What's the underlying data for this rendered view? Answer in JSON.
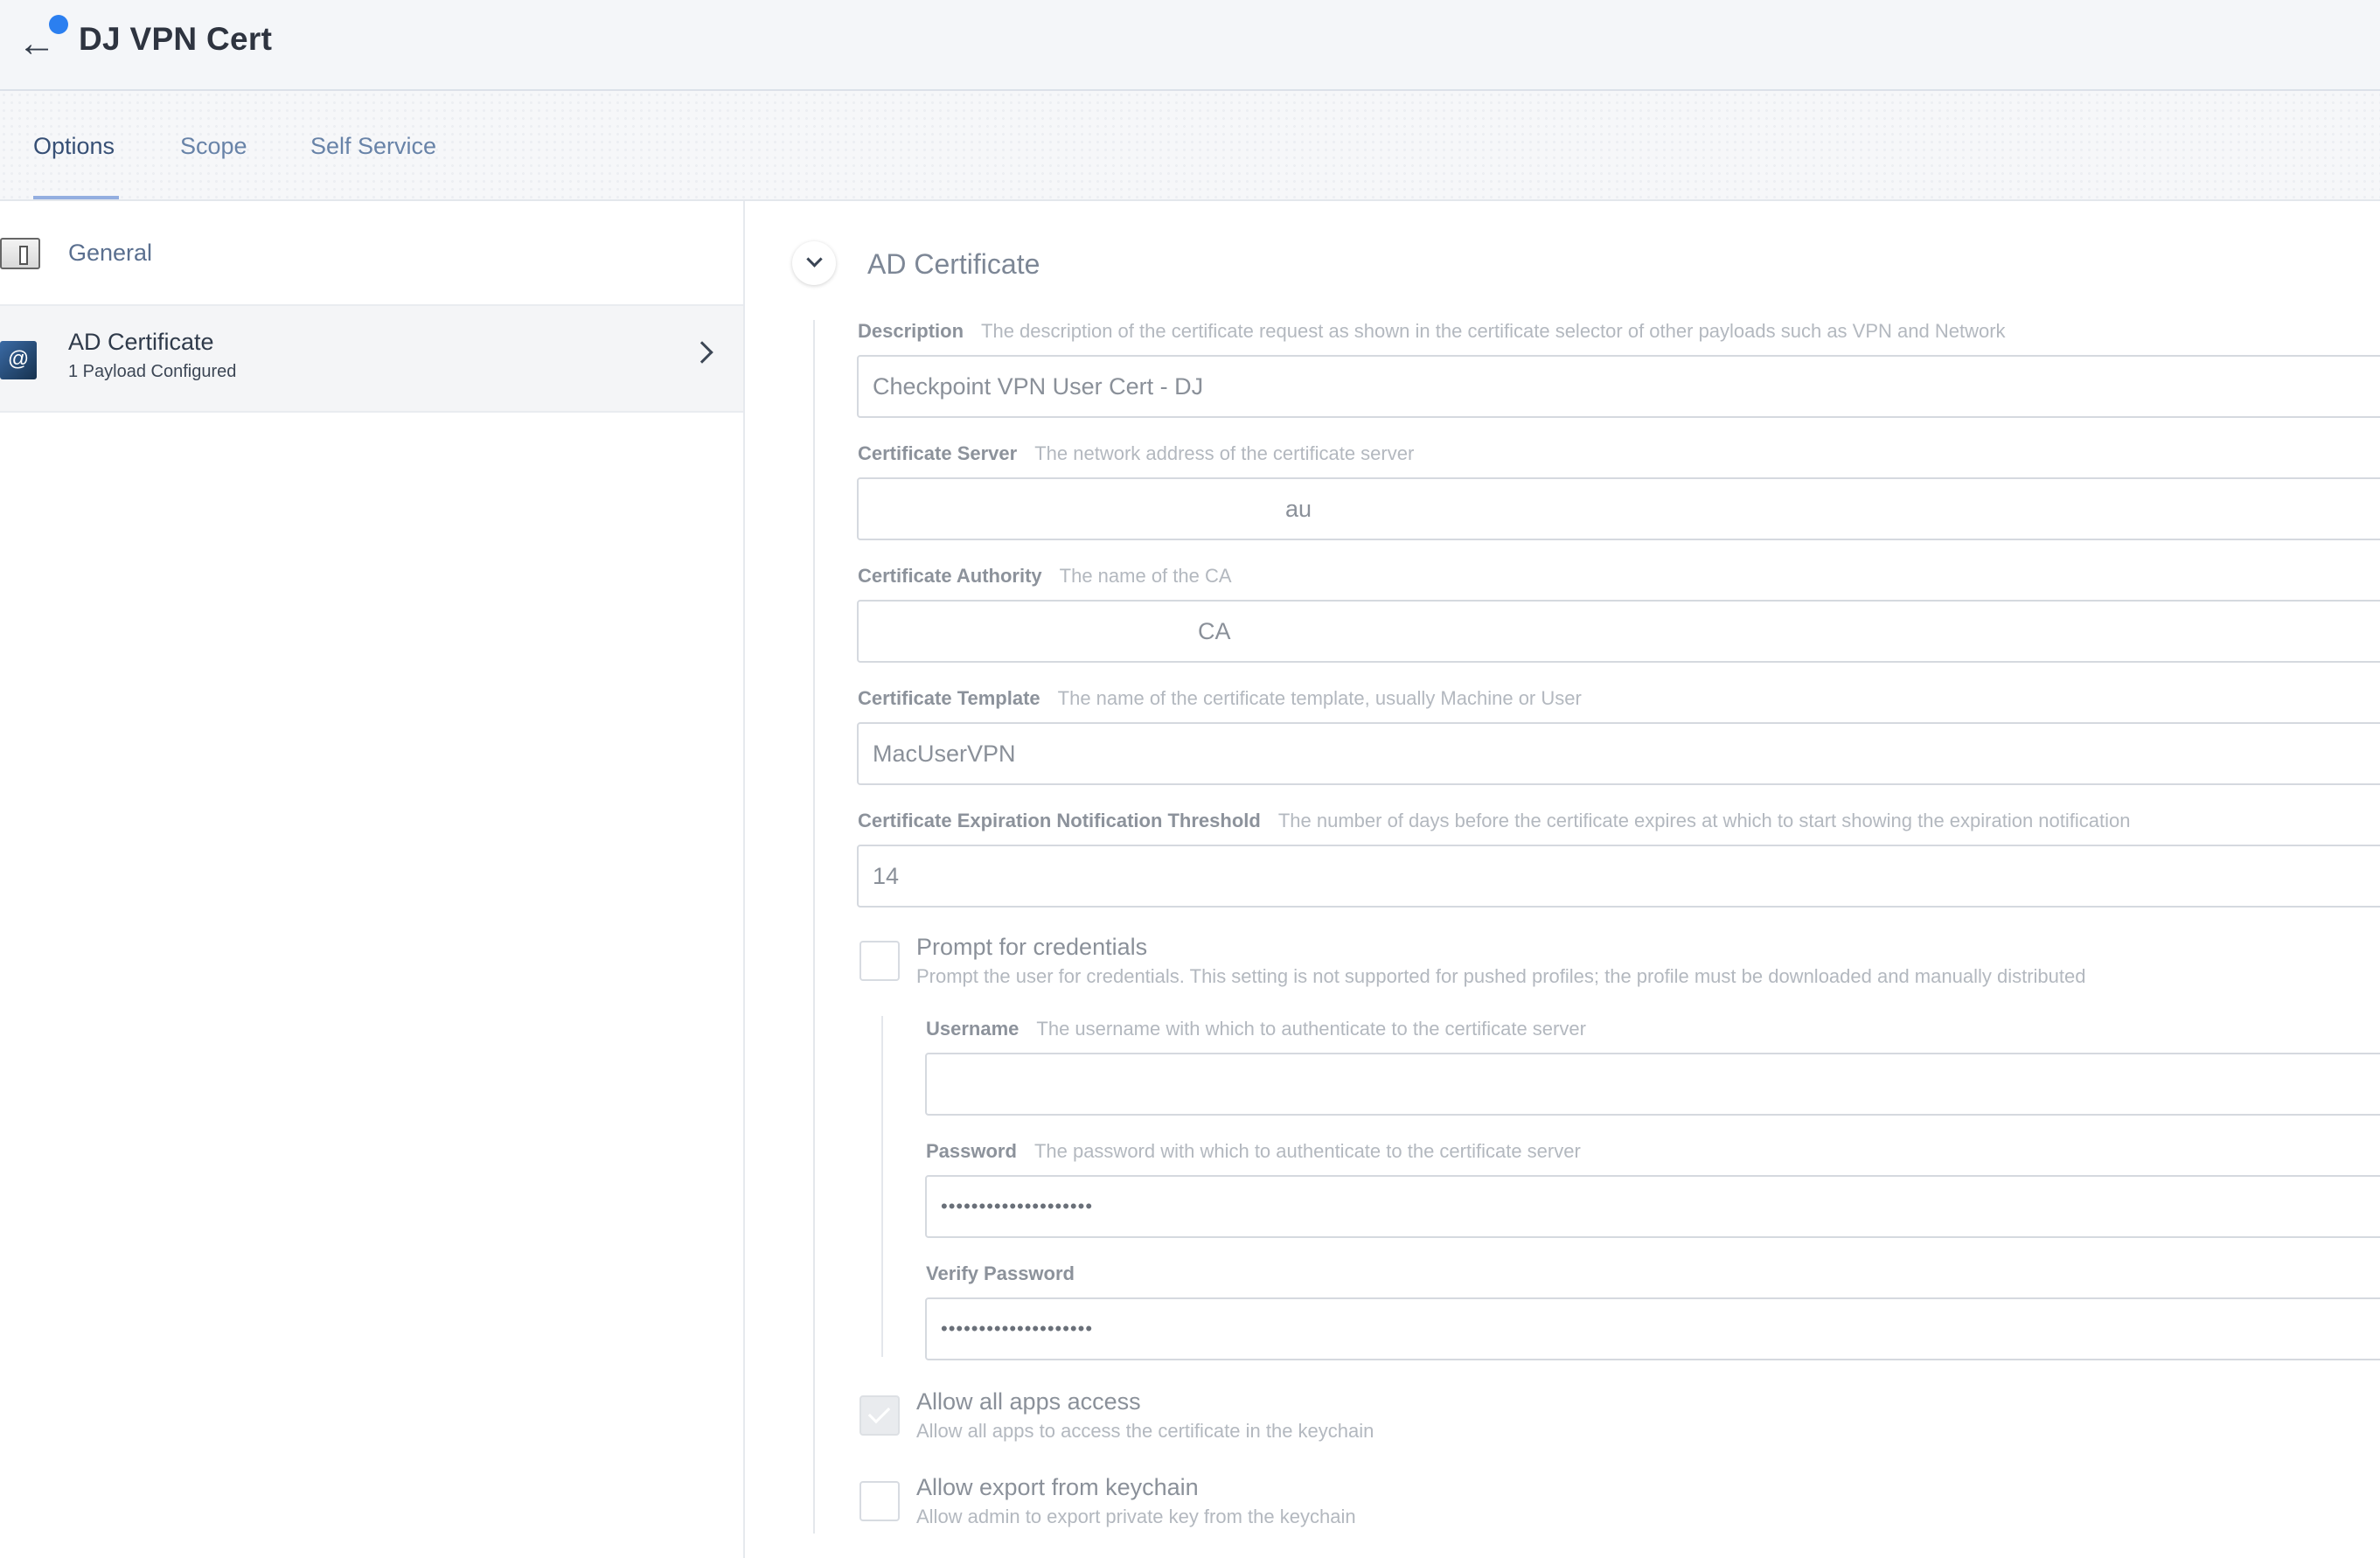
{
  "header": {
    "title": "DJ VPN Cert",
    "back_icon": "arrow-left-icon",
    "back_glyph": "←",
    "notification_color": "#2b7ff0"
  },
  "tabs": [
    {
      "label": "Options",
      "active": true
    },
    {
      "label": "Scope",
      "active": false
    },
    {
      "label": "Self Service",
      "active": false
    }
  ],
  "sidebar": {
    "items": [
      {
        "label": "General",
        "icon": "switch-icon"
      },
      {
        "label": "AD Certificate",
        "sublabel": "1 Payload Configured",
        "icon": "certificate-icon",
        "icon_glyph": "@",
        "selected": true
      }
    ]
  },
  "section": {
    "title": "AD Certificate",
    "fields": {
      "description": {
        "label": "Description",
        "help": "The description of the certificate request as shown in the certificate selector of other payloads such as VPN and Network",
        "value": "Checkpoint VPN User Cert - DJ"
      },
      "server": {
        "label": "Certificate Server",
        "help": "The network address of the certificate server",
        "value": "au"
      },
      "authority": {
        "label": "Certificate Authority",
        "help": "The name of the CA",
        "value": "CA"
      },
      "template": {
        "label": "Certificate Template",
        "help": "The name of the certificate template, usually Machine or User",
        "value": "MacUserVPN"
      },
      "threshold": {
        "label": "Certificate Expiration Notification Threshold",
        "help": "The number of days before the certificate expires at which to start showing the expiration notification",
        "value": "14"
      },
      "username": {
        "label": "Username",
        "help": "The username with which to authenticate to the certificate server",
        "value": ""
      },
      "password": {
        "label": "Password",
        "help": "The password with which to authenticate to the certificate server",
        "value": "••••••••••••••••••••"
      },
      "verify_password": {
        "label": "Verify Password",
        "help": "",
        "value": "••••••••••••••••••••"
      }
    },
    "checkboxes": {
      "prompt": {
        "title": "Prompt for credentials",
        "description": "Prompt the user for credentials. This setting is not supported for pushed profiles; the profile must be downloaded and manually distributed",
        "checked": false
      },
      "allow_all_apps": {
        "title": "Allow all apps access",
        "description": "Allow all apps to access the certificate in the keychain",
        "checked": true
      },
      "allow_export": {
        "title": "Allow export from keychain",
        "description": "Allow admin to export private key from the keychain",
        "checked": false
      }
    }
  }
}
